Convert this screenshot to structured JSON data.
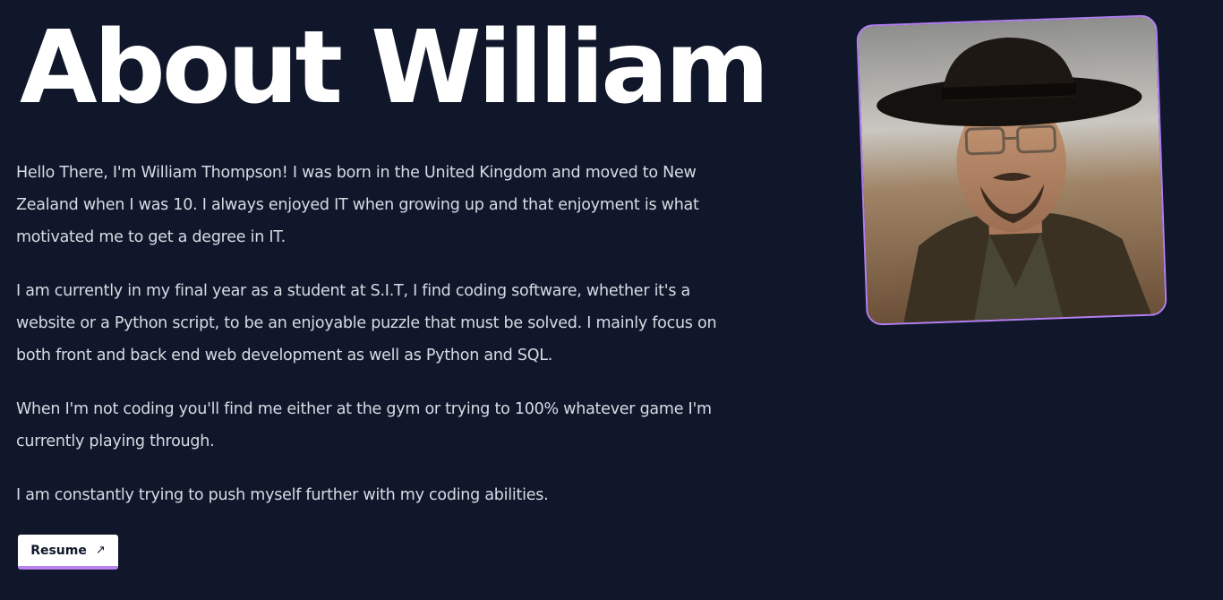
{
  "about": {
    "title": "About William",
    "paragraphs": [
      "Hello There, I'm William Thompson! I was born in the United Kingdom and moved to New Zealand when I was 10. I always enjoyed IT when growing up and that enjoyment is what motivated me to get a degree in IT.",
      "I am currently in my final year as a student at S.I.T, I find coding software, whether it's a website or a Python script, to be an enjoyable puzzle that must be solved. I mainly focus on both front and back end web development as well as Python and SQL.",
      "When I'm not coding you'll find me either at the gym or trying to 100% whatever game I'm currently playing through.",
      "I am constantly trying to push myself further with my coding abilities."
    ],
    "resume_button": {
      "label": "Resume",
      "icon": "arrow-up-right-icon"
    }
  },
  "portrait": {
    "icon": "profile-photo",
    "frame_color": "#b37ff0"
  },
  "colors": {
    "background": "#10172a",
    "title": "#ffffff",
    "text": "#d7dbe4",
    "accent": "#b983f0"
  }
}
